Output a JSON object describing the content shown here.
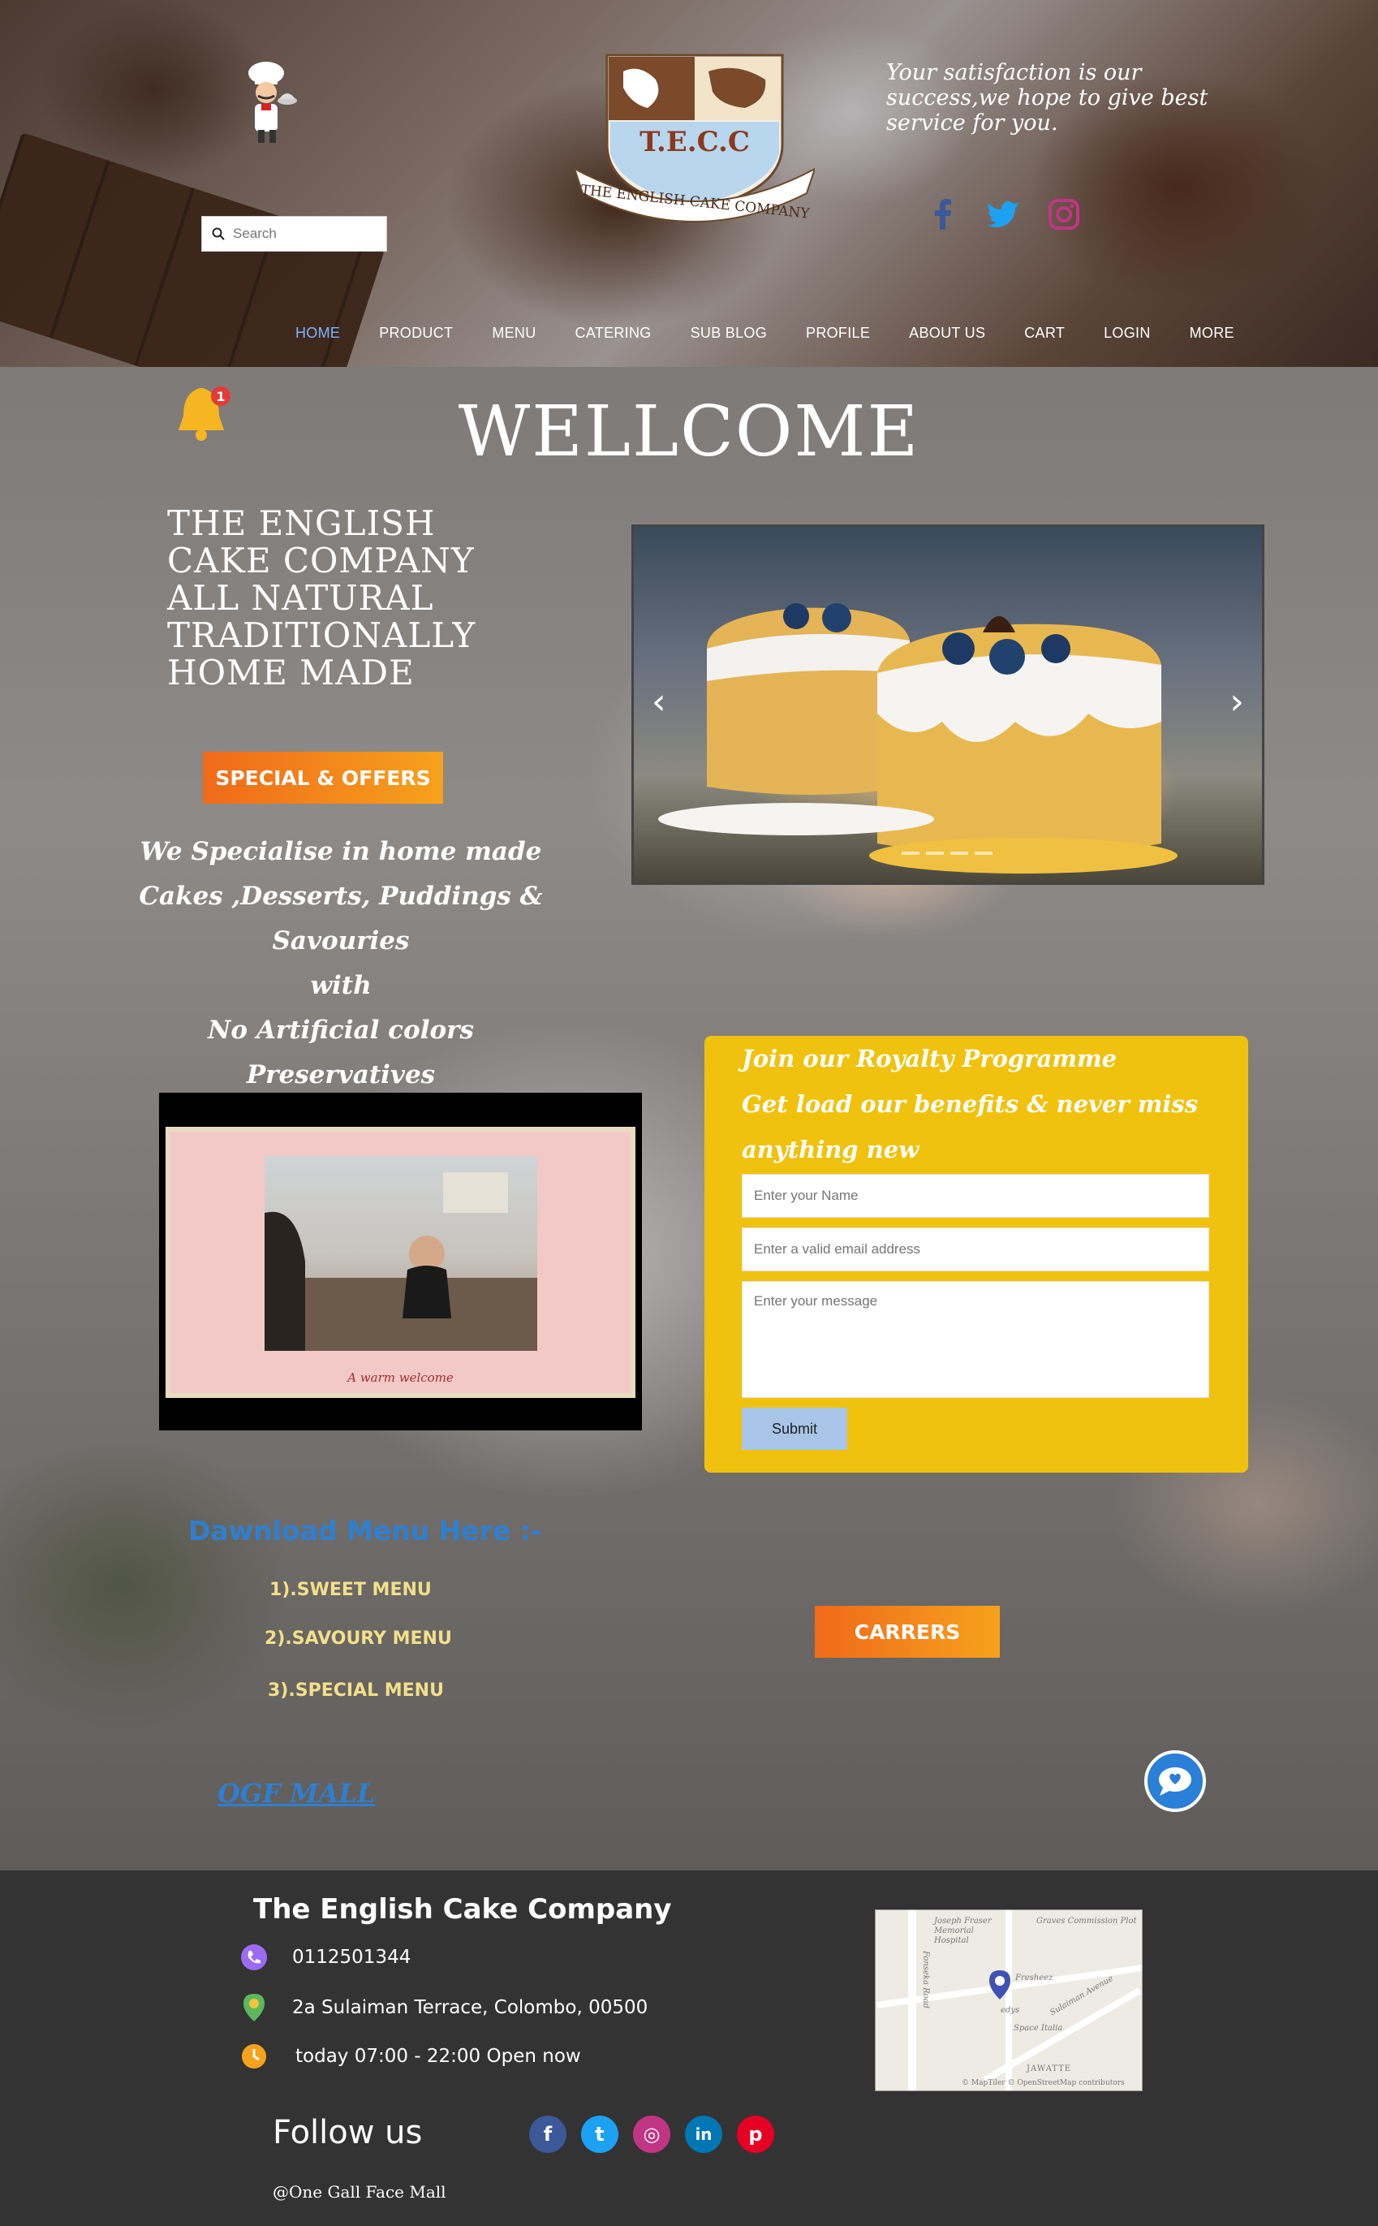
{
  "header": {
    "search_placeholder": "Search",
    "tagline": "Your satisfaction is our success,we hope to give best service for you.",
    "logo_text": "T.E.C.C",
    "logo_banner": "THE ENGLISH CAKE COMPANY",
    "social_icons": [
      "facebook-icon",
      "twitter-icon",
      "instagram-icon"
    ],
    "nav": [
      "HOME",
      "PRODUCT",
      "MENU",
      "CATERING",
      "SUB BLOG",
      "PROFILE",
      "ABOUT US",
      "CART",
      "LOGIN",
      "MORE"
    ]
  },
  "main": {
    "welcome": "WELLCOME",
    "notification_count": "1",
    "hero_title": "THE ENGLISH CAKE COMPANY ALL NATURAL TRADITIONALLY HOME MADE",
    "special_button": "SPECIAL & OFFERS",
    "specialise_lines": [
      "We Specialise in home made",
      "Cakes ,Desserts, Puddings & Savouries",
      "with",
      "No Artificial colors",
      "Preservatives"
    ],
    "carousel": {
      "prev": "‹",
      "next": "›"
    },
    "video_caption": "A warm welcome",
    "royalty": {
      "lines": [
        "Join our Royalty Programme",
        "Get load our benefits & never miss",
        "anything new"
      ],
      "name_placeholder": "Enter your Name",
      "email_placeholder": "Enter a valid email address",
      "message_placeholder": "Enter your message",
      "submit": "Submit"
    },
    "download_title": "Dawnload Menu Here :-",
    "menu_links": [
      "1).SWEET MENU",
      "2).SAVOURY MENU",
      "3).SPECIAL MENU"
    ],
    "careers_button": "CARRERS",
    "ogf_mall": "OGF MALL"
  },
  "footer": {
    "title": "The English Cake Company",
    "phone": "0112501344",
    "address": "2a Sulaiman Terrace, Colombo, 00500",
    "hours": "today 07:00 - 22:00 Open now",
    "map_labels": {
      "hospital": "Joseph Fraser Memorial Hospital",
      "graves": "Graves Commission Plot",
      "fonseka": "Fonseka Road",
      "freshez": "Fresheez",
      "sulaiman": "Sulaiman Avenue",
      "edys": "edys",
      "space": "Space Italia",
      "jawatte": "JAWATTE",
      "credit": "© MapTiler © OpenStreetMap contributors"
    },
    "follow_us": "Follow us",
    "social": [
      {
        "icon": "facebook-icon",
        "glyph": "f",
        "color": "#3b5998"
      },
      {
        "icon": "twitter-icon",
        "glyph": "t",
        "color": "#1da1f2"
      },
      {
        "icon": "instagram-icon",
        "glyph": "◎",
        "color": "#c13584"
      },
      {
        "icon": "linkedin-icon",
        "glyph": "in",
        "color": "#0077b5"
      },
      {
        "icon": "pinterest-icon",
        "glyph": "p",
        "color": "#e60023"
      }
    ],
    "mall": "@One Gall Face Mall"
  },
  "colors": {
    "accent_nav": "#7fb4ff",
    "royalty_bg": "#f0c20e",
    "orange_start": "#f06a1a",
    "orange_end": "#f6a21c",
    "link_blue": "#2f7fd0",
    "footer_bg": "#333333"
  }
}
